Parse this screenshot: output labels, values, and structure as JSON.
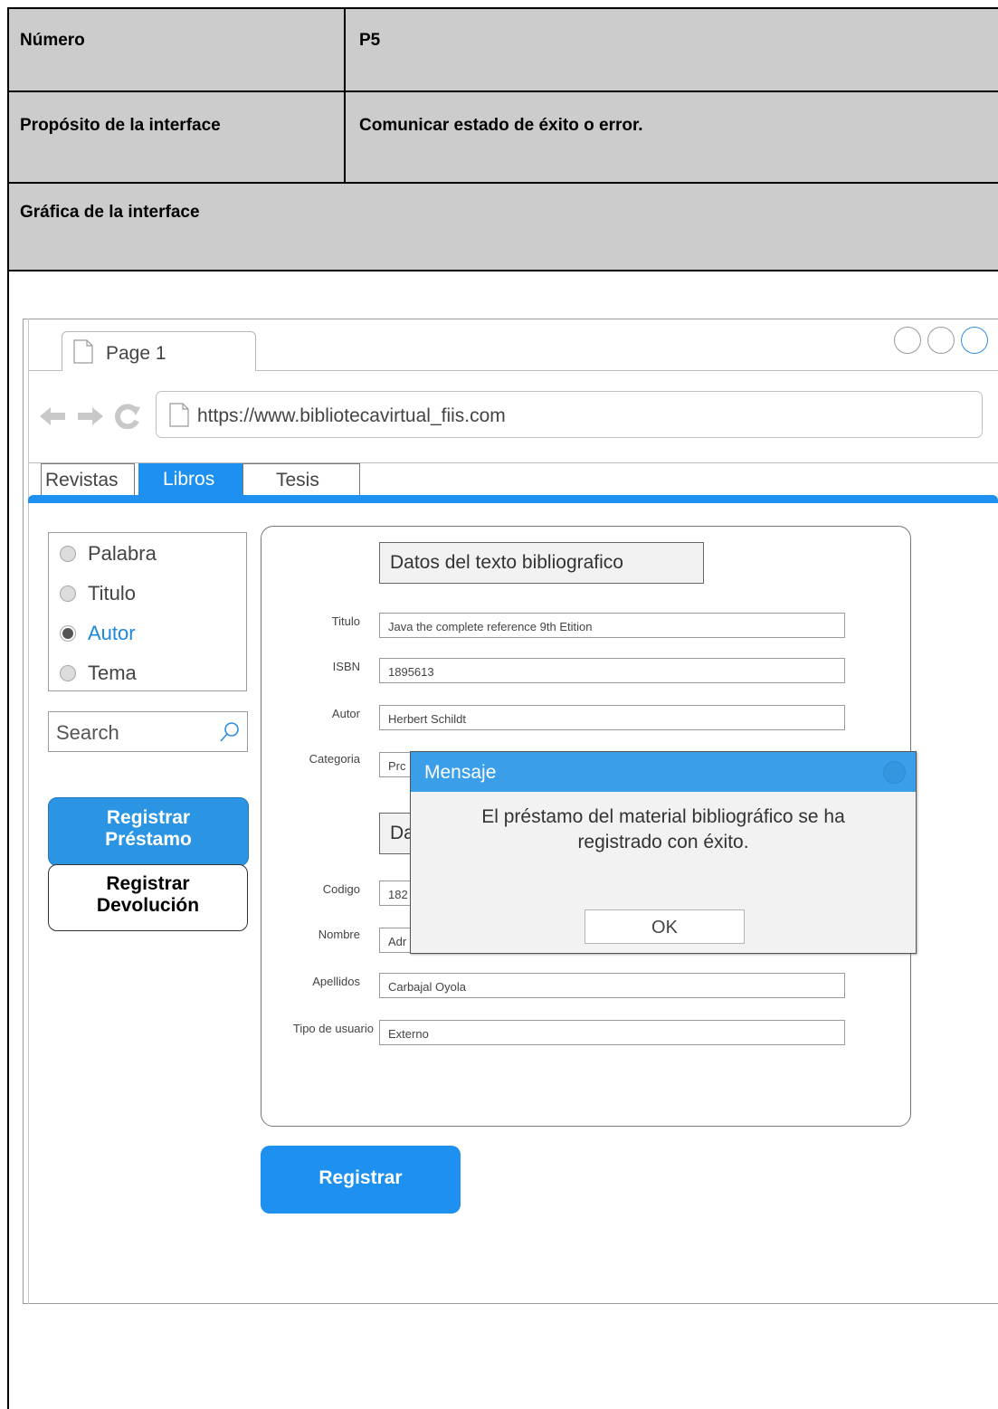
{
  "doc": {
    "row1": {
      "label": "Número",
      "value": "P5"
    },
    "row2": {
      "label": "Propósito de la interface",
      "value": "Comunicar estado de éxito o error."
    },
    "row3": {
      "label": "Gráfica de la interface"
    }
  },
  "browser": {
    "tab_label": "Page 1",
    "url": "https://www.bibliotecavirtual_fiis.com",
    "nav_tabs": [
      "Revistas",
      "Libros",
      "Tesis"
    ],
    "active_tab": "Libros"
  },
  "sidebar": {
    "radios": [
      {
        "label": "Palabra",
        "selected": false
      },
      {
        "label": "Titulo",
        "selected": false
      },
      {
        "label": "Autor",
        "selected": true
      },
      {
        "label": "Tema",
        "selected": false
      }
    ],
    "search_placeholder": "Search",
    "btn_prestamo": {
      "line1": "Registrar",
      "line2": "Préstamo"
    },
    "btn_devolucion": {
      "line1": "Registrar",
      "line2": "Devolución"
    }
  },
  "form": {
    "section1_title": "Datos del texto bibliografico",
    "section2_title_visible": "Da",
    "fields1": [
      {
        "label": "Titulo",
        "value": "Java the complete reference 9th Etition"
      },
      {
        "label": "ISBN",
        "value": "1895613"
      },
      {
        "label": "Autor",
        "value": "Herbert Schildt"
      },
      {
        "label": "Categoria",
        "value": "Prc"
      }
    ],
    "fields2": [
      {
        "label": "Codigo",
        "value": "182"
      },
      {
        "label": "Nombre",
        "value": "Adr"
      },
      {
        "label": "Apellidos",
        "value": "Carbajal Oyola"
      },
      {
        "label": "Tipo de usuario",
        "value": "Externo"
      }
    ],
    "submit_label": "Registrar"
  },
  "dialog": {
    "title": "Mensaje",
    "message_line1": "El préstamo del material bibliográfico se ha",
    "message_line2": "registrado con éxito.",
    "ok_label": "OK"
  },
  "colors": {
    "accent": "#1e90f0",
    "doc_gray": "#cccccc",
    "dialog_header": "#3a9ee8"
  }
}
